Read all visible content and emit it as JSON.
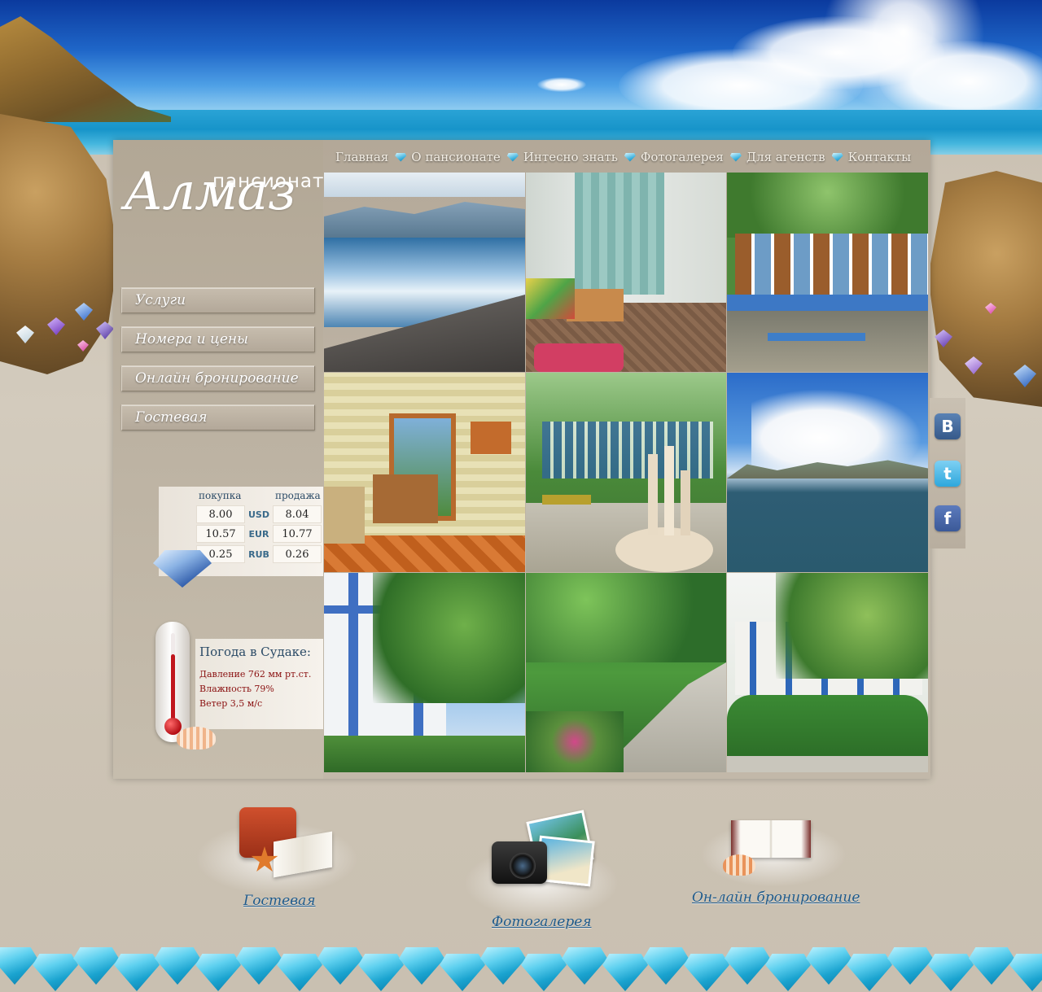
{
  "brand": {
    "small": "пансионат",
    "big": "Алмаз"
  },
  "nav": [
    "Главная",
    "О пансионате",
    "Интесно знать",
    "Фотогалерея",
    "Для агенств",
    "Контакты"
  ],
  "side_menu": [
    "Услуги",
    "Номера и цены",
    "Онлайн бронирование",
    "Гостевая"
  ],
  "currency": {
    "buy_header": "покупка",
    "sell_header": "продажа",
    "rows": [
      {
        "code": "USD",
        "buy": "8.00",
        "sell": "8.04"
      },
      {
        "code": "EUR",
        "buy": "10.57",
        "sell": "10.77"
      },
      {
        "code": "RUB",
        "buy": "0.25",
        "sell": "0.26"
      }
    ]
  },
  "weather": {
    "title": "Погода в Судаке:",
    "pressure": "Давление 762 мм рт.ст.",
    "humidity": "Влажность 79%",
    "wind": "Ветер 3,5 м/с"
  },
  "social": {
    "vk": "B",
    "twitter": "t",
    "facebook": "f"
  },
  "promos": {
    "guestbook": "Гостевая",
    "gallery": "Фотогалерея",
    "booking": "Он-лайн бронирование"
  },
  "colors": {
    "accent": "#1f5a8a",
    "panel": "#b8ae9f",
    "nav_text": "#f4efe6",
    "weather_text": "#8a1010"
  }
}
